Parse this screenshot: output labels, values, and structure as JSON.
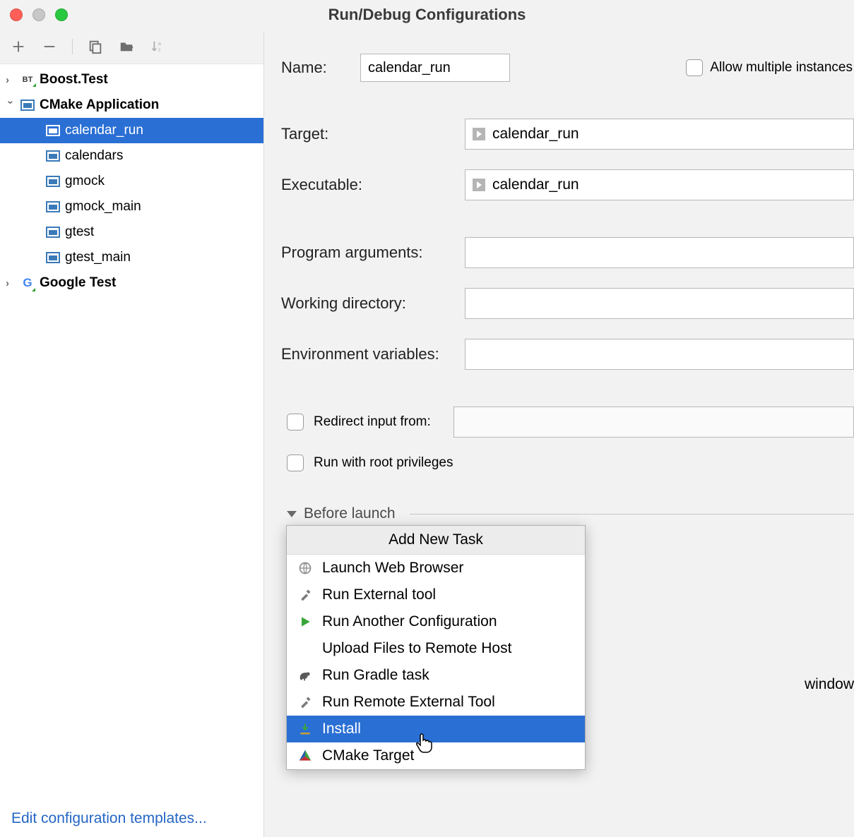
{
  "window": {
    "title": "Run/Debug Configurations"
  },
  "sidebar": {
    "toolbar": {
      "add": "add-icon",
      "remove": "remove-icon",
      "copy": "copy-icon",
      "folder": "save-template-icon",
      "sort": "sort-icon"
    },
    "tree": [
      {
        "label": "Boost.Test",
        "type": "boost",
        "expanded": false,
        "depth": 1
      },
      {
        "label": "CMake Application",
        "type": "cmake-group",
        "expanded": true,
        "depth": 1
      },
      {
        "label": "calendar_run",
        "type": "cmake",
        "selected": true,
        "depth": 2
      },
      {
        "label": "calendars",
        "type": "cmake",
        "depth": 2
      },
      {
        "label": "gmock",
        "type": "cmake",
        "depth": 2
      },
      {
        "label": "gmock_main",
        "type": "cmake",
        "depth": 2
      },
      {
        "label": "gtest",
        "type": "cmake",
        "depth": 2
      },
      {
        "label": "gtest_main",
        "type": "cmake",
        "depth": 2
      },
      {
        "label": "Google Test",
        "type": "gtest",
        "expanded": false,
        "depth": 1
      }
    ],
    "edit_templates": "Edit configuration templates..."
  },
  "form": {
    "name_label": "Name:",
    "name_value": "calendar_run",
    "allow_multiple": "Allow multiple instances",
    "target_label": "Target:",
    "target_value": "calendar_run",
    "executable_label": "Executable:",
    "executable_value": "calendar_run",
    "program_args_label": "Program arguments:",
    "program_args_value": "",
    "working_dir_label": "Working directory:",
    "working_dir_value": "",
    "env_vars_label": "Environment variables:",
    "env_vars_value": "",
    "redirect_label": "Redirect input from:",
    "root_priv_label": "Run with root privileges",
    "before_launch_label": "Before launch",
    "tool_window_suffix": "window"
  },
  "popup": {
    "header": "Add New Task",
    "items": [
      {
        "label": "Launch Web Browser",
        "icon": "globe"
      },
      {
        "label": "Run External tool",
        "icon": "tools"
      },
      {
        "label": "Run Another Configuration",
        "icon": "play"
      },
      {
        "label": "Upload Files to Remote Host",
        "icon": "none"
      },
      {
        "label": "Run Gradle task",
        "icon": "elephant"
      },
      {
        "label": "Run Remote External Tool",
        "icon": "tools"
      },
      {
        "label": "Install",
        "icon": "install",
        "selected": true
      },
      {
        "label": "CMake Target",
        "icon": "cmake"
      }
    ]
  }
}
